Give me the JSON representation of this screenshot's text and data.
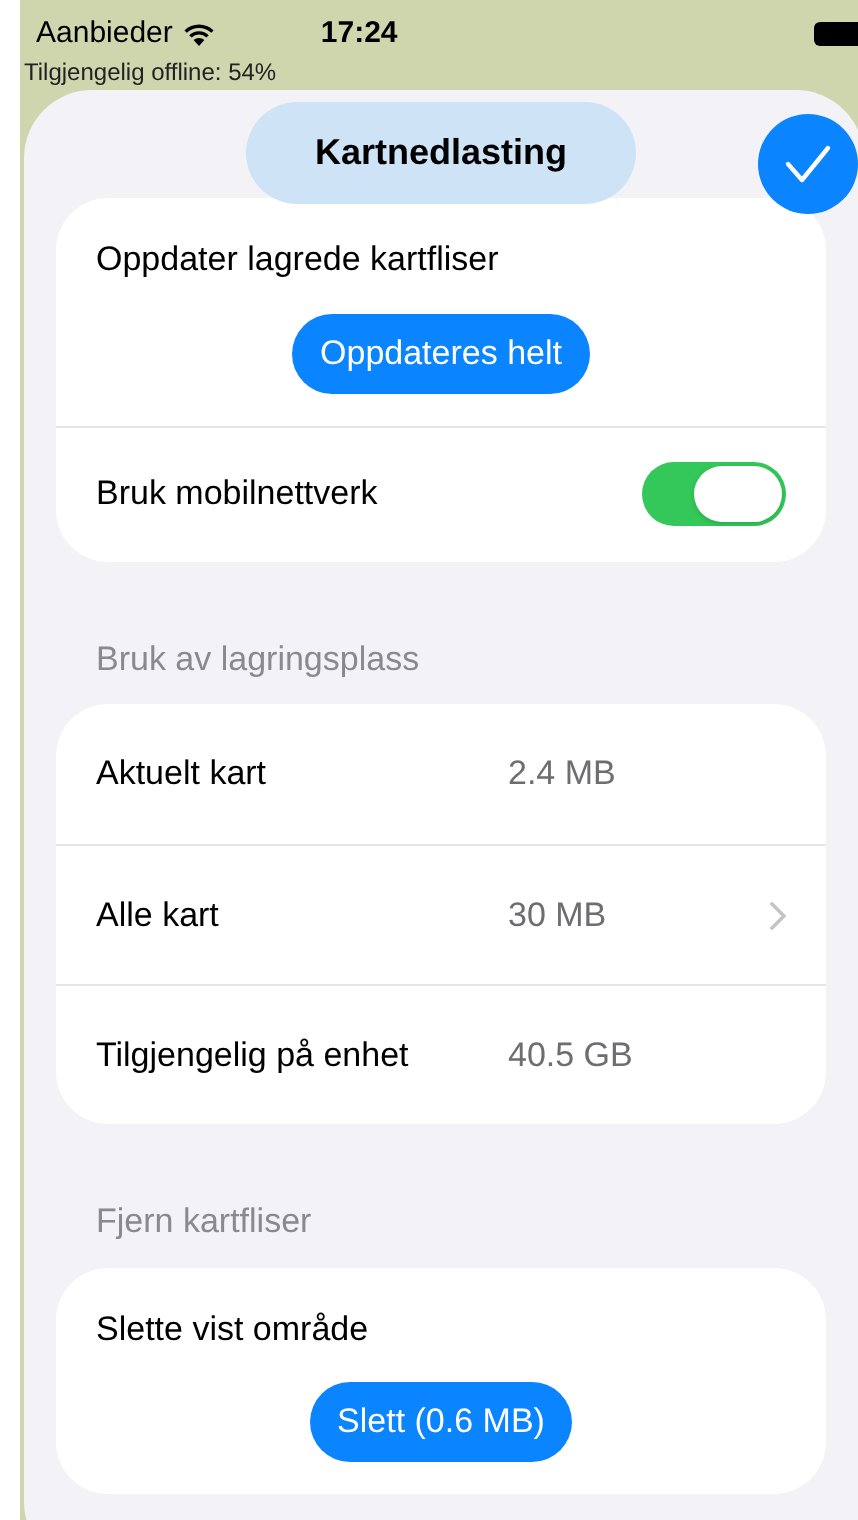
{
  "status_bar": {
    "carrier": "Aanbieder",
    "time": "17:24"
  },
  "map_overlay": {
    "offline_text": "Tilgjengelig offline: 54%"
  },
  "sheet": {
    "title": "Kartnedlasting"
  },
  "sections": [
    {
      "rows": [
        {
          "kind": "action",
          "label": "Oppdater lagrede kartfliser",
          "button": "Oppdateres helt"
        },
        {
          "kind": "toggle",
          "label": "Bruk mobilnettverk",
          "on": true
        }
      ]
    },
    {
      "header": "Bruk av lagringsplass",
      "rows": [
        {
          "kind": "value",
          "label": "Aktuelt kart",
          "value": "2.4 MB",
          "chevron": false
        },
        {
          "kind": "value",
          "label": "Alle kart",
          "value": "30 MB",
          "chevron": true
        },
        {
          "kind": "value",
          "label": "Tilgjengelig på enhet",
          "value": "40.5 GB",
          "chevron": false
        }
      ]
    },
    {
      "header": "Fjern kartfliser",
      "rows": [
        {
          "kind": "action",
          "label": "Slette vist område",
          "button": "Slett (0.6 MB)"
        }
      ]
    }
  ]
}
